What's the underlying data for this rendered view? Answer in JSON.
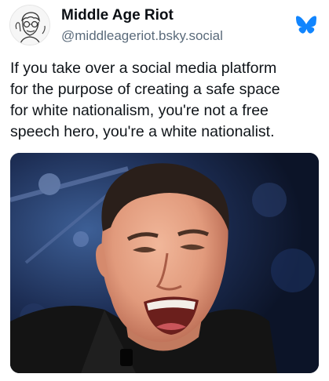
{
  "author": {
    "display_name": "Middle Age Riot",
    "handle": "@middleageriot.bsky.social",
    "avatar_icon": "cartoon-face-avatar"
  },
  "platform_icon": "bluesky-butterfly-icon",
  "colors": {
    "brand_blue": "#1185fe",
    "handle_gray": "#5b6b7b",
    "text": "#0f1419"
  },
  "post": {
    "text_lines": [
      "If you take over a social media platform",
      "for the purpose of creating a safe space",
      "for white nationalism, you're not a free",
      "speech hero, you're a white nationalist."
    ]
  },
  "media": {
    "kind": "photo",
    "subject": "smiling-man-photo"
  }
}
